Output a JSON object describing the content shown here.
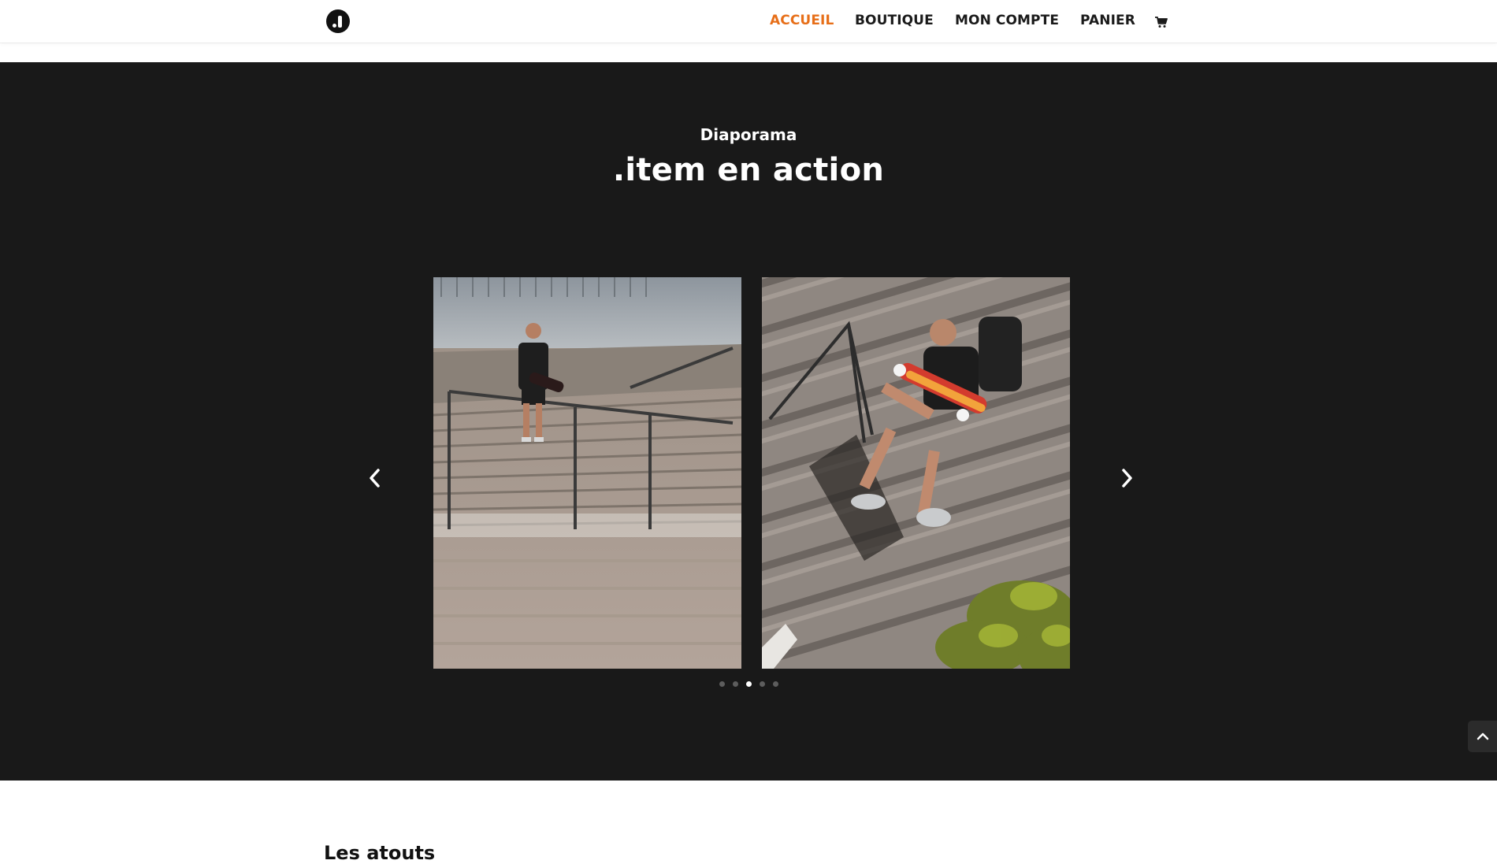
{
  "header": {
    "logo_icon": "brand-logo-icon",
    "nav": [
      {
        "label": "ACCUEIL",
        "active": true
      },
      {
        "label": "BOUTIQUE",
        "active": false
      },
      {
        "label": "MON COMPTE",
        "active": false
      },
      {
        "label": "PANIER",
        "active": false
      }
    ],
    "cart_icon": "shopping-cart-icon",
    "active_color": "#e76f19"
  },
  "slider_section": {
    "kicker": "Diaporama",
    "title": ".item en action",
    "background": "#191919",
    "slides": [
      {
        "icon": "photo-skater-walking-down-stairs"
      },
      {
        "icon": "photo-skater-sitting-on-stairs"
      }
    ],
    "prev_icon": "chevron-left-icon",
    "next_icon": "chevron-right-icon",
    "dots_count": 5,
    "active_dot": 3
  },
  "back_to_top_icon": "chevron-up-icon",
  "next_section": {
    "heading": "Les atouts"
  }
}
